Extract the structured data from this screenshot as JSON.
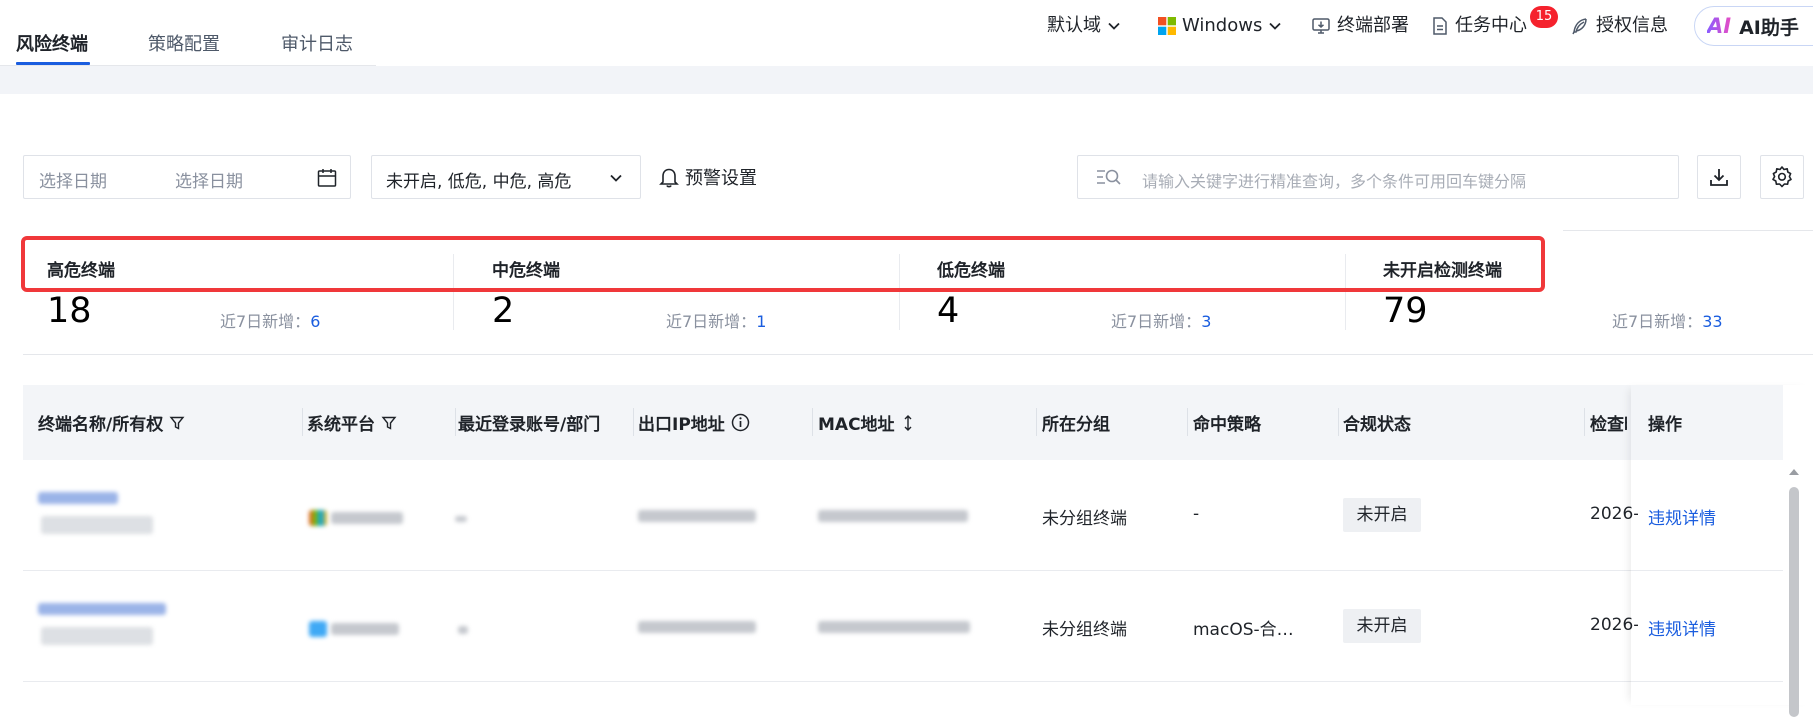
{
  "tabs": [
    {
      "label": "风险终端",
      "active": true
    },
    {
      "label": "策略配置",
      "active": false
    },
    {
      "label": "审计日志",
      "active": false
    }
  ],
  "nav": {
    "domain": "默认域",
    "platform": "Windows",
    "deploy": "终端部署",
    "task_center": "任务中心",
    "task_badge": "15",
    "license": "授权信息",
    "ai_logo": "AI",
    "ai_label": "AI助手"
  },
  "filters": {
    "date_start_placeholder": "选择日期",
    "date_end_placeholder": "选择日期",
    "risk_level_value": "未开启, 低危, 中危, 高危",
    "alert_settings": "预警设置",
    "search_placeholder": "请输入关键字进行精准查询，多个条件可用回车键分隔"
  },
  "stats": [
    {
      "title": "高危终端",
      "count": "18",
      "new_label": "近7日新增：",
      "new_count": "6"
    },
    {
      "title": "中危终端",
      "count": "2",
      "new_label": "近7日新增：",
      "new_count": "1"
    },
    {
      "title": "低危终端",
      "count": "4",
      "new_label": "近7日新增：",
      "new_count": "3"
    },
    {
      "title": "未开启检测终端",
      "count": "79",
      "new_label": "近7日新增：",
      "new_count": "33"
    }
  ],
  "table": {
    "columns": [
      "终端名称/所有权",
      "系统平台",
      "最近登录账号/部门",
      "出口IP地址",
      "MAC地址",
      "所在分组",
      "命中策略",
      "合规状态",
      "检查时间",
      "操作"
    ],
    "rows": [
      {
        "group": "未分组终端",
        "policy": "-",
        "status": "未开启",
        "check_time": "2026-",
        "action": "违规详情"
      },
      {
        "group": "未分组终端",
        "policy": "macOS-合…",
        "status": "未开启",
        "check_time": "2026-",
        "action": "违规详情"
      }
    ]
  },
  "colors": {
    "accent": "#1a5ddf",
    "highlight_border": "#f0383a",
    "badge": "#f5222d"
  }
}
